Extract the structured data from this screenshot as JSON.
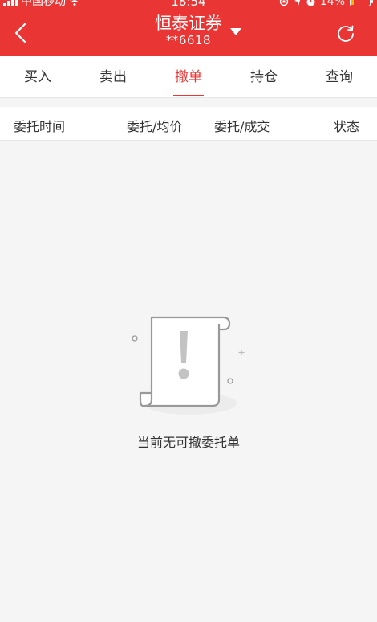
{
  "status_bar": {
    "carrier": "中国移动",
    "time": "18:54",
    "battery": "14%"
  },
  "header": {
    "title": "恒泰证券",
    "account": "**6618"
  },
  "tabs": [
    {
      "label": "买入"
    },
    {
      "label": "卖出"
    },
    {
      "label": "撤单",
      "active": true
    },
    {
      "label": "持仓"
    },
    {
      "label": "查询"
    }
  ],
  "columns": [
    "委托时间",
    "委托/均价",
    "委托/成交",
    "状态"
  ],
  "empty": {
    "message": "当前无可撤委托单"
  },
  "colors": {
    "brand": "#e93533",
    "background": "#f5f5f5"
  }
}
